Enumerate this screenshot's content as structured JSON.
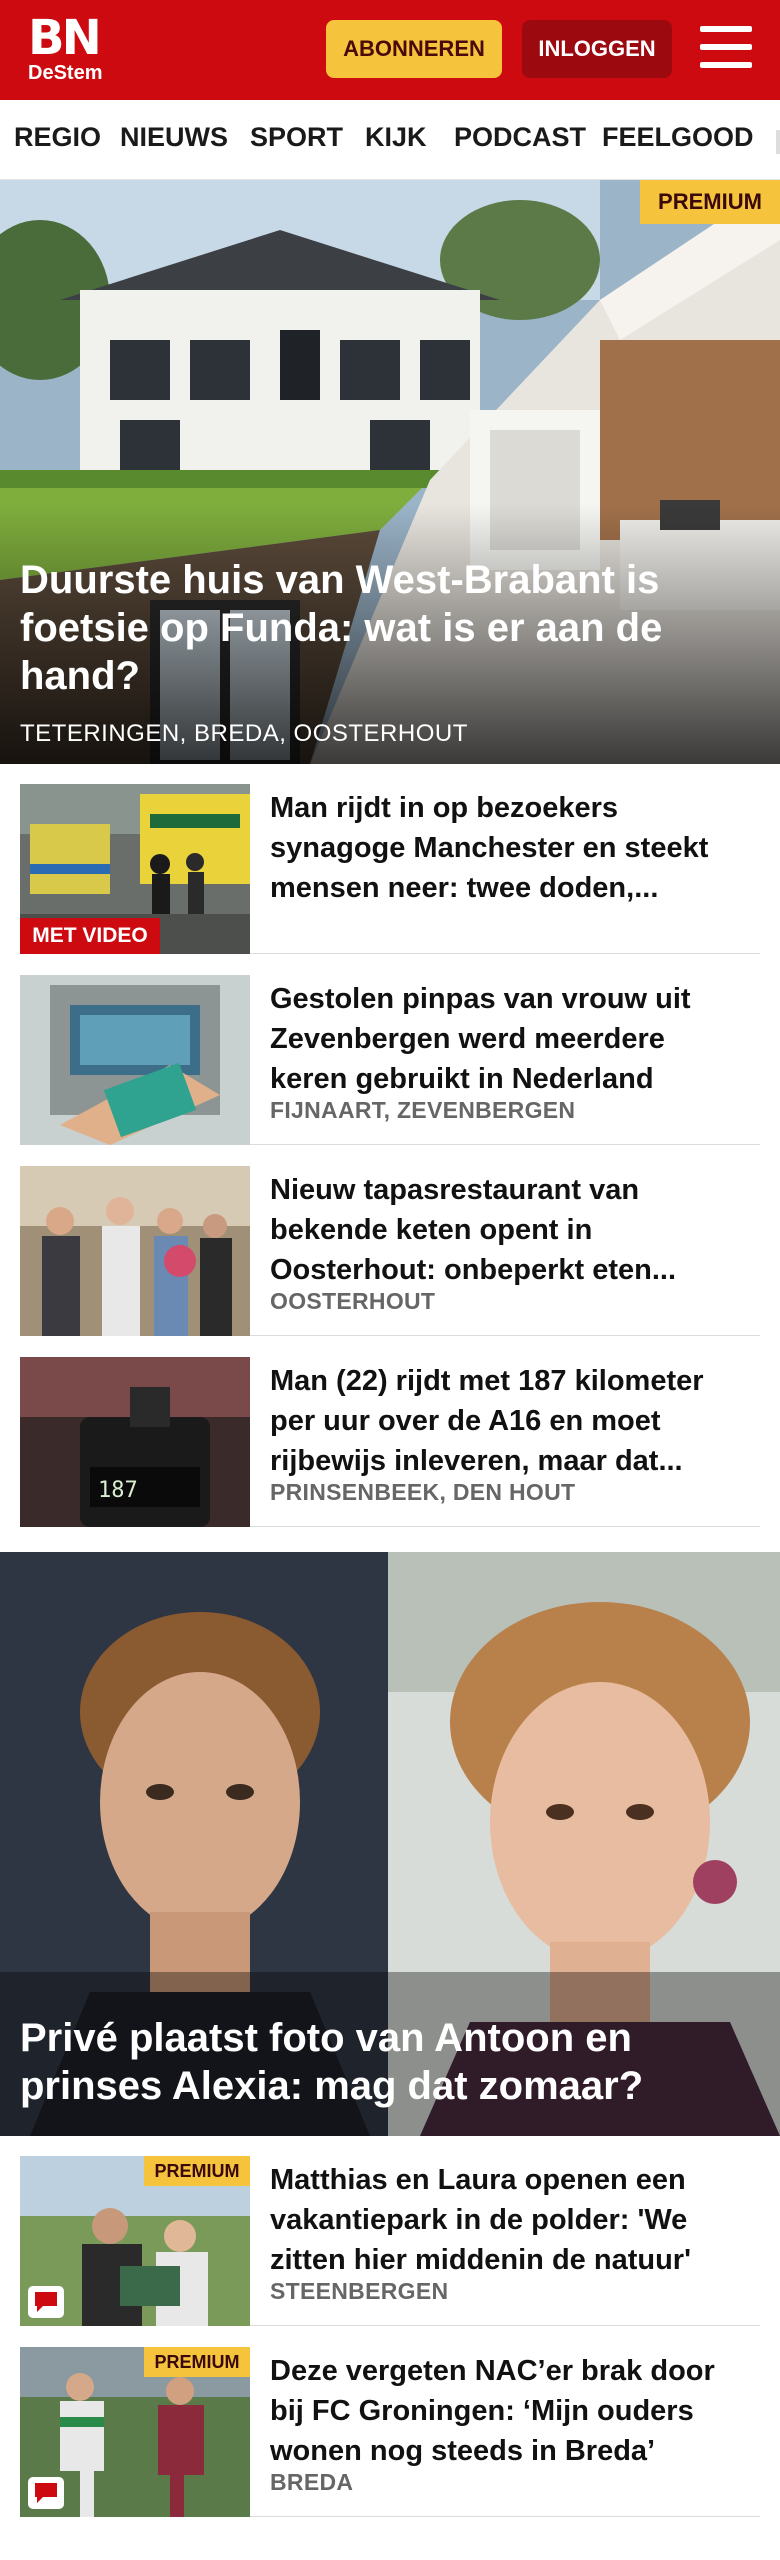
{
  "header": {
    "logo_main": "BN",
    "logo_sub": "DeStem",
    "subscribe_label": "ABONNEREN",
    "login_label": "INLOGGEN",
    "brand_color": "#cc0a0f",
    "accent_color": "#f6c33d"
  },
  "nav": {
    "items": [
      "REGIO",
      "NIEUWS",
      "SPORT",
      "KIJK",
      "PODCAST",
      "FEELGOOD"
    ]
  },
  "hero": {
    "badge": "PREMIUM",
    "title": "Duurste huis van West-Brabant is foetsie op Funda: wat is er aan de hand?",
    "tags": "TETERINGEN, BREDA, OOSTERHOUT"
  },
  "articles": [
    {
      "title": "Man rijdt in op bezoekers synagoge Manchester en steekt mensen neer: twee doden,...",
      "badge": "MET VIDEO",
      "tags": ""
    },
    {
      "title": "Gestolen pinpas van vrouw uit Zevenbergen werd meerdere keren gebruikt in Nederland",
      "tags": "FIJNAART, ZEVENBERGEN"
    },
    {
      "title": "Nieuw tapasrestaurant van bekende keten opent in Oosterhout: onbeperkt eten...",
      "tags": "OOSTERHOUT"
    },
    {
      "title": "Man (22) rijdt met 187 kilometer per uur over de A16 en moet rijbewijs inleveren, maar dat...",
      "tags": "PRINSENBEEK, DEN HOUT",
      "speed_readout": "187"
    }
  ],
  "hero2": {
    "title": "Privé plaatst foto van Antoon en prinses Alexia: mag dat zomaar?"
  },
  "articles2": [
    {
      "title": "Matthias en Laura openen een vakantiepark in de polder: 'We zitten hier middenin de natuur'",
      "tags": "STEENBERGEN",
      "badge": "PREMIUM",
      "icon": "comment-icon"
    },
    {
      "title": "Deze vergeten NAC’er brak door bij FC Groningen: ‘Mijn ouders wonen nog steeds in Breda’",
      "tags": "BREDA",
      "badge": "PREMIUM",
      "icon": "comment-icon"
    }
  ]
}
